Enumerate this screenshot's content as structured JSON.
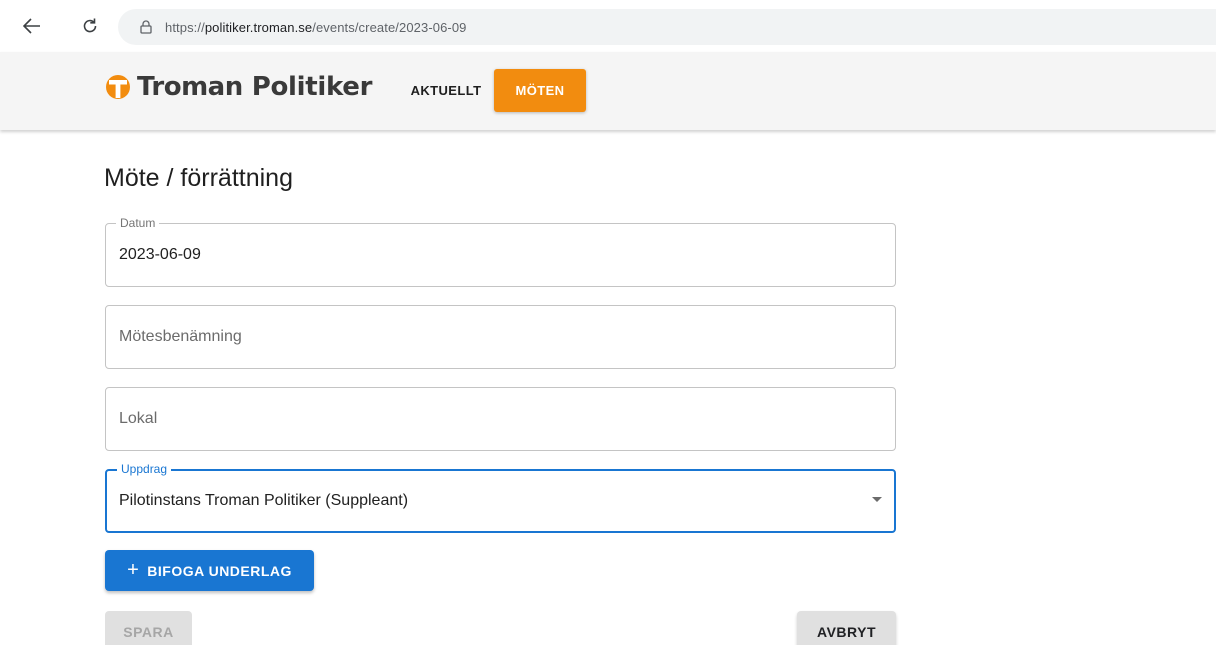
{
  "browser": {
    "url_prefix": "https://",
    "url_domain": "politiker.troman.se",
    "url_path": "/events/create/2023-06-09"
  },
  "header": {
    "logo_word1": "Troman",
    "logo_word2": "Politiker",
    "nav": {
      "aktuellt": "AKTUELLT",
      "moten": "MÖTEN"
    },
    "accent_color": "#f28c0f"
  },
  "page": {
    "title": "Möte / förrättning"
  },
  "form": {
    "date": {
      "label": "Datum",
      "value": "2023-06-09"
    },
    "meeting_name": {
      "placeholder": "Mötesbenämning"
    },
    "location": {
      "placeholder": "Lokal"
    },
    "assignment": {
      "label": "Uppdrag",
      "value": "Pilotinstans Troman Politiker (Suppleant)"
    },
    "attach_button": "BIFOGA UNDERLAG",
    "save_button": "SPARA",
    "cancel_button": "AVBRYT"
  },
  "colors": {
    "primary": "#1976d2",
    "brand_orange": "#f28c0f"
  },
  "icons": {
    "back": "arrow-left-icon",
    "reload": "reload-icon",
    "site_info": "lock-icon",
    "dropdown": "caret-down-icon",
    "attach": "plus-icon"
  }
}
